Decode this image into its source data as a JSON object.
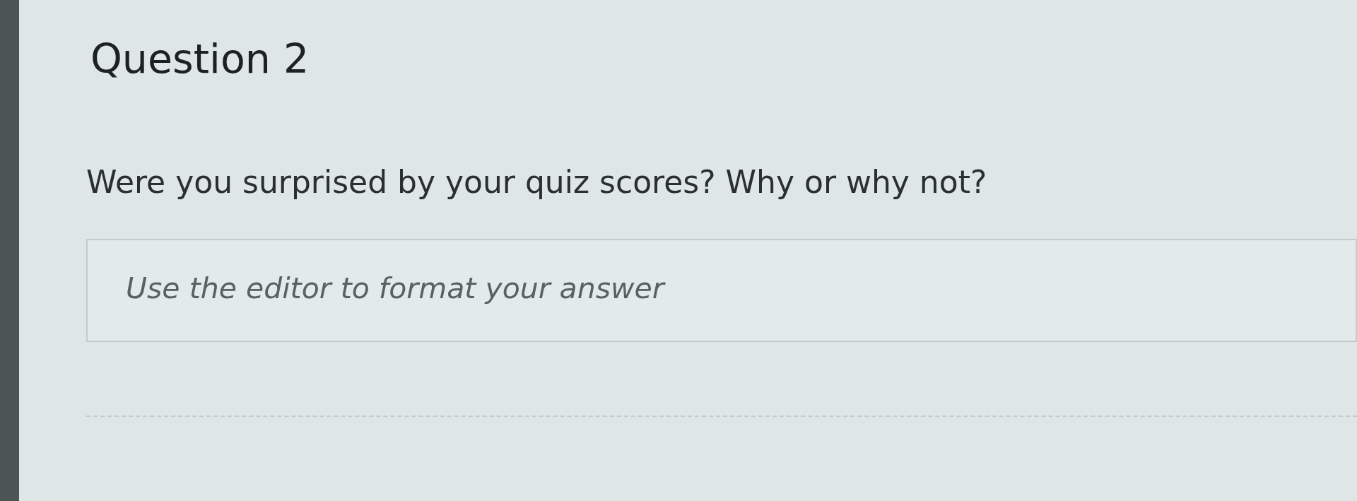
{
  "question": {
    "title": "Question 2",
    "prompt": "Were you surprised by your quiz scores? Why or why not?"
  },
  "answer": {
    "placeholder": "Use the editor to format your answer"
  }
}
